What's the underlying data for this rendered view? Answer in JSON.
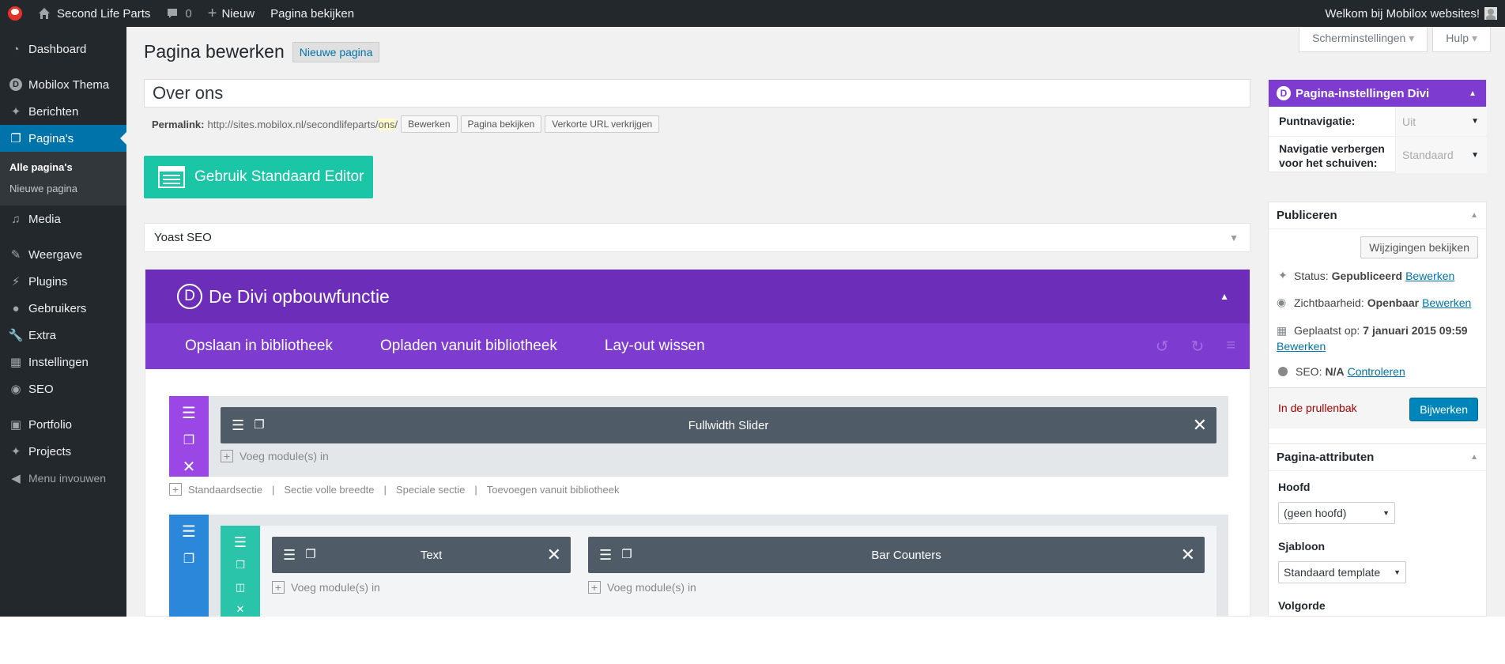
{
  "adminbar": {
    "site_name": "Second Life Parts",
    "comments_count": "0",
    "new_label": "Nieuw",
    "view_page_label": "Pagina bekijken",
    "welcome": "Welkom bij Mobilox websites!"
  },
  "sidebar": {
    "items": [
      {
        "label": "Dashboard",
        "icon": "dashboard-icon"
      },
      {
        "label": "Mobilox Thema",
        "icon": "divi-icon"
      },
      {
        "label": "Berichten",
        "icon": "pin-icon"
      },
      {
        "label": "Pagina's",
        "icon": "pages-icon",
        "active": true
      },
      {
        "label": "Media",
        "icon": "media-icon"
      },
      {
        "label": "Weergave",
        "icon": "brush-icon"
      },
      {
        "label": "Plugins",
        "icon": "plugin-icon"
      },
      {
        "label": "Gebruikers",
        "icon": "users-icon"
      },
      {
        "label": "Extra",
        "icon": "wrench-icon"
      },
      {
        "label": "Instellingen",
        "icon": "settings-icon"
      },
      {
        "label": "SEO",
        "icon": "seo-icon"
      },
      {
        "label": "Portfolio",
        "icon": "folder-icon"
      },
      {
        "label": "Projects",
        "icon": "pin-icon"
      }
    ],
    "submenu": [
      "Alle pagina's",
      "Nieuwe pagina"
    ],
    "collapse_label": "Menu invouwen"
  },
  "screen_tabs": {
    "screen_options": "Scherminstellingen",
    "help": "Hulp"
  },
  "page": {
    "title": "Pagina bewerken",
    "add_new": "Nieuwe pagina",
    "post_title": "Over ons",
    "permalink_label": "Permalink:",
    "permalink_base": "http://sites.mobilox.nl/secondlifeparts/",
    "permalink_slug": "ons",
    "permalink_trail": "/",
    "edit_btn": "Bewerken",
    "view_btn": "Pagina bekijken",
    "shortlink_btn": "Verkorte URL verkrijgen",
    "std_editor_btn": "Gebruik Standaard Editor",
    "yoast_label": "Yoast SEO"
  },
  "divi": {
    "title": "De Divi opbouwfunctie",
    "logo_letter": "D",
    "tools": [
      "Opslaan in bibliotheek",
      "Opladen vanuit bibliotheek",
      "Lay-out wissen"
    ],
    "add_module": "Voeg module(s) in",
    "section1_module": "Fullwidth Slider",
    "section_links": [
      "Standaardsectie",
      "Sectie volle breedte",
      "Speciale sectie",
      "Toevoegen vanuit bibliotheek"
    ],
    "section2_modules": [
      "Text",
      "Bar Counters"
    ]
  },
  "right": {
    "divi_settings": {
      "title": "Pagina-instellingen Divi",
      "dot_nav_label": "Puntnavigatie:",
      "dot_nav_value": "Uit",
      "hide_nav_label_1": "Navigatie verbergen",
      "hide_nav_label_2": "voor het schuiven:",
      "hide_nav_value": "Standaard"
    },
    "publish": {
      "title": "Publiceren",
      "preview_btn": "Wijzigingen bekijken",
      "status_label": "Status:",
      "status_value": "Gepubliceerd",
      "visibility_label": "Zichtbaarheid:",
      "visibility_value": "Openbaar",
      "date_label": "Geplaatst op:",
      "date_value": "7 januari 2015 09:59",
      "seo_label": "SEO:",
      "seo_value": "N/A",
      "seo_link": "Controleren",
      "edit_link": "Bewerken",
      "trash": "In de prullenbak",
      "update_btn": "Bijwerken"
    },
    "attributes": {
      "title": "Pagina-attributen",
      "parent_label": "Hoofd",
      "parent_value": "(geen hoofd)",
      "template_label": "Sjabloon",
      "template_value": "Standaard template",
      "order_label": "Volgorde"
    }
  }
}
